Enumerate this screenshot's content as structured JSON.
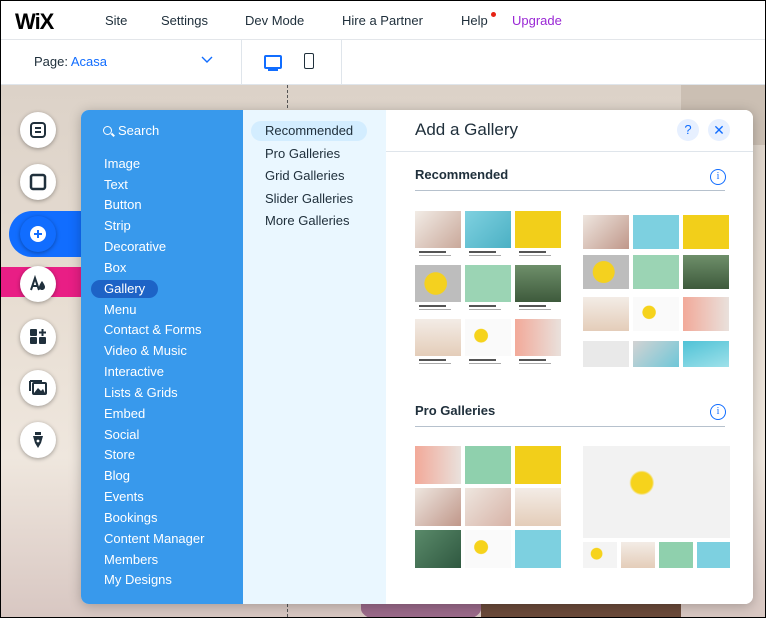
{
  "topbar": {
    "logo": "WiX",
    "menu": [
      "Site",
      "Settings",
      "Dev Mode",
      "Hire a Partner",
      "Help",
      "Upgrade"
    ]
  },
  "pagebar": {
    "page_label": "Page: ",
    "page_value": "Acasa"
  },
  "rail": {
    "buttons": [
      "pages-icon",
      "background-icon",
      "add-icon",
      "theme-icon",
      "app-market-icon",
      "media-icon",
      "blog-pen-icon"
    ]
  },
  "panel": {
    "search_label": "Search",
    "categories": [
      "Image",
      "Text",
      "Button",
      "Strip",
      "Decorative",
      "Box",
      "Gallery",
      "Menu",
      "Contact & Forms",
      "Video & Music",
      "Interactive",
      "Lists & Grids",
      "Embed",
      "Social",
      "Store",
      "Blog",
      "Events",
      "Bookings",
      "Content Manager",
      "Members",
      "My Designs"
    ],
    "selected_category": "Gallery",
    "subcategories": [
      "Recommended",
      "Pro Galleries",
      "Grid Galleries",
      "Slider Galleries",
      "More Galleries"
    ],
    "selected_subcategory": "Recommended",
    "title": "Add a Gallery",
    "help_label": "?",
    "close_label": "✕",
    "sections": [
      {
        "title": "Recommended",
        "info": "i"
      },
      {
        "title": "Pro Galleries",
        "info": "i"
      }
    ]
  },
  "colors": {
    "accent": "#116dff",
    "category_bg": "#3899ec",
    "subcategory_bg": "#eaf7ff",
    "upgrade": "#9a27d5",
    "highlight_pink": "#e91e85"
  }
}
